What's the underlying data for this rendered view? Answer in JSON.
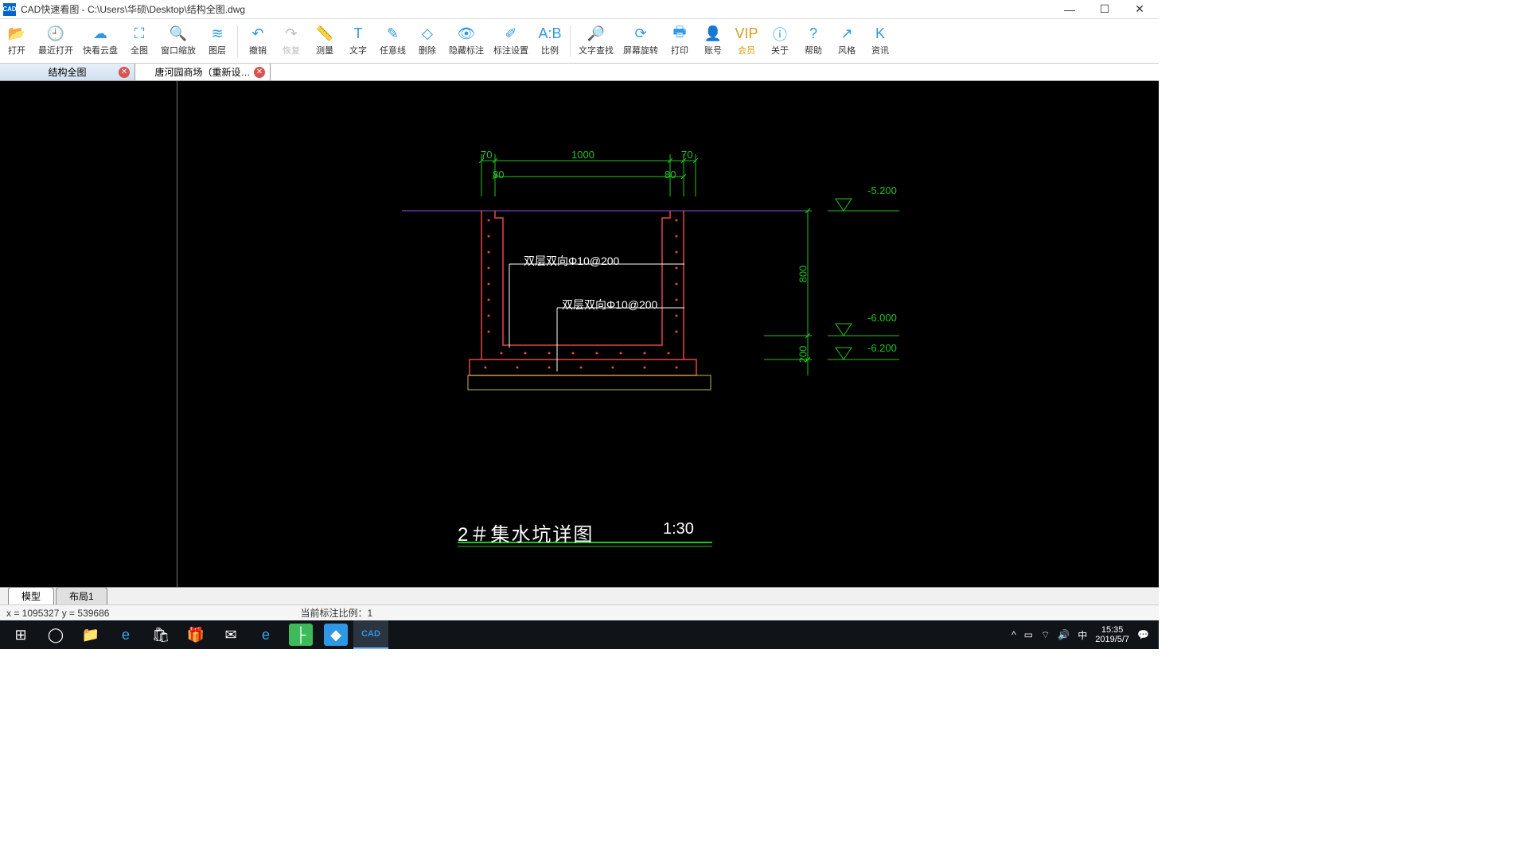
{
  "window": {
    "app_icon_text": "CAD",
    "title": "CAD快速看图 - C:\\Users\\华硕\\Desktop\\结构全图.dwg"
  },
  "toolbar": [
    {
      "id": "open",
      "label": "打开",
      "color": "#2e97e6"
    },
    {
      "id": "recent",
      "label": "最近打开",
      "color": "#2e97e6"
    },
    {
      "id": "cloud",
      "label": "快看云盘",
      "color": "#2e97e6"
    },
    {
      "id": "fullview",
      "label": "全图",
      "color": "#2e97e6"
    },
    {
      "id": "zoomwin",
      "label": "窗口缩放",
      "color": "#2e97e6"
    },
    {
      "id": "layer",
      "label": "图层",
      "color": "#2e97e6"
    },
    {
      "sep": true
    },
    {
      "id": "undo",
      "label": "撤销",
      "color": "#2e97e6"
    },
    {
      "id": "redo",
      "label": "恢复",
      "color": "#bbb",
      "disabled": true
    },
    {
      "id": "measure",
      "label": "测量",
      "color": "#2e97e6"
    },
    {
      "id": "text",
      "label": "文字",
      "color": "#2e97e6"
    },
    {
      "id": "line",
      "label": "任意线",
      "color": "#2e97e6"
    },
    {
      "id": "delete",
      "label": "删除",
      "color": "#2e97e6"
    },
    {
      "id": "hidemark",
      "label": "隐藏标注",
      "color": "#2e97e6"
    },
    {
      "id": "markset",
      "label": "标注设置",
      "color": "#2e97e6"
    },
    {
      "id": "scale",
      "label": "比例",
      "color": "#2e97e6"
    },
    {
      "sep": true
    },
    {
      "id": "findtext",
      "label": "文字查找",
      "color": "#2e97e6"
    },
    {
      "id": "rotate",
      "label": "屏幕旋转",
      "color": "#2e97e6"
    },
    {
      "id": "print",
      "label": "打印",
      "color": "#2e97e6"
    },
    {
      "id": "account",
      "label": "账号",
      "color": "#2e97e6"
    },
    {
      "id": "vip",
      "label": "会员",
      "color": "#d4a017",
      "vip": true
    },
    {
      "id": "about",
      "label": "关于",
      "color": "#2e97e6"
    },
    {
      "id": "help",
      "label": "帮助",
      "color": "#2e97e6"
    },
    {
      "id": "style",
      "label": "风格",
      "color": "#2e97e6"
    },
    {
      "id": "info",
      "label": "资讯",
      "color": "#2e97e6"
    }
  ],
  "file_tabs": [
    {
      "label": "结构全图",
      "active": true
    },
    {
      "label": "唐河园商场（重新设…",
      "active": false
    }
  ],
  "drawing": {
    "dim_top_left": "70",
    "dim_top_mid": "1000",
    "dim_top_right": "70",
    "dim_80_left": "80",
    "dim_80_right": "80",
    "rebar1": "双层双向Φ10@200",
    "rebar2": "双层双向Φ10@200",
    "elev1": "-5.200",
    "elev2": "-6.000",
    "elev3": "-6.200",
    "vdim_800": "800",
    "vdim_200": "200",
    "title": "2＃集水坑详图",
    "scale": "1:30"
  },
  "bottom_tabs": [
    {
      "label": "模型",
      "active": true
    },
    {
      "label": "布局1",
      "active": false
    }
  ],
  "status": {
    "coords": "x = 1095327  y = 539686",
    "dim_scale": "当前标注比例：1"
  },
  "tray": {
    "ime": "中",
    "time": "15:35",
    "date": "2019/5/7"
  }
}
